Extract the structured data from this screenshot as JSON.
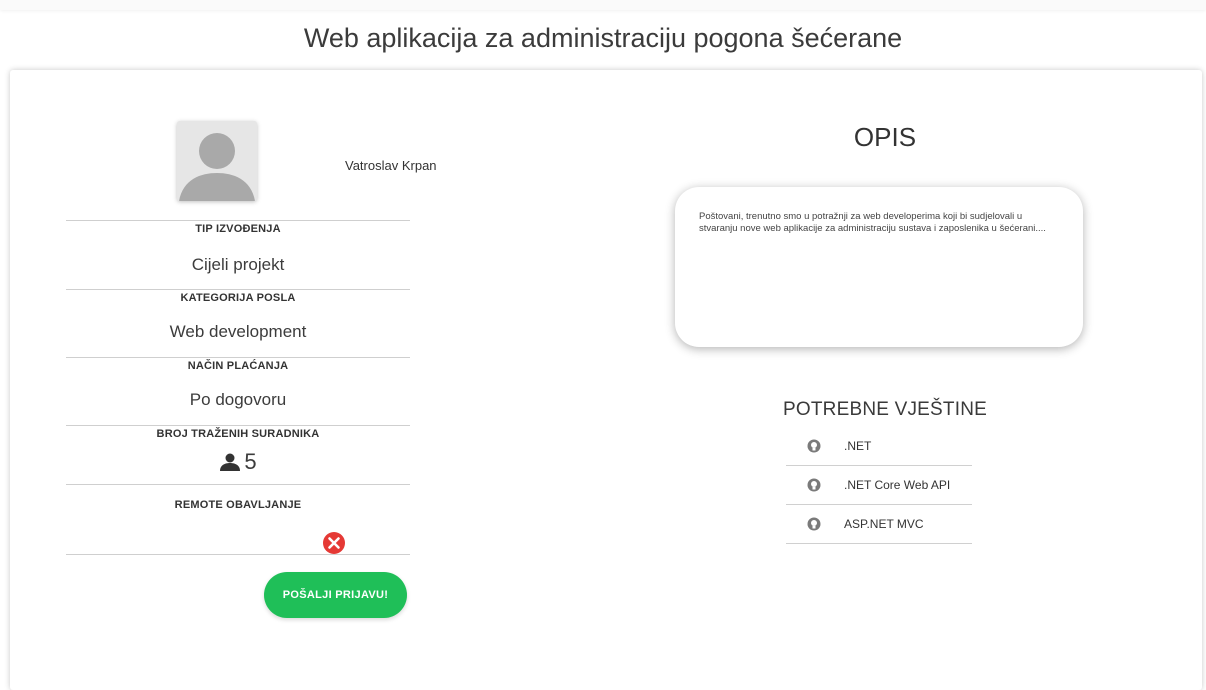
{
  "page": {
    "title": "Web aplikacija za administraciju pogona šećerane"
  },
  "job": {
    "author_name": "Vatroslav Krpan",
    "sections": [
      {
        "label": "TIP IZVOĐENJA",
        "value": "Cijeli projekt"
      },
      {
        "label": "KATEGORIJA POSLA",
        "value": "Web development"
      },
      {
        "label": "NAČIN PLAĆANJA",
        "value": "Po dogovoru"
      }
    ],
    "collaborators": {
      "label": "BROJ TRAŽENIH SURADNIKA",
      "value": "5",
      "icon": "person-icon"
    },
    "remote": {
      "label": "REMOTE OBAVLJANJE",
      "allowed": false,
      "icon": "remote-no-icon"
    },
    "apply_button": "POŠALJI PRIJAVU!"
  },
  "description": {
    "heading": "OPIS",
    "text": "Poštovani, trenutno smo u potražnji za web developerima koji bi sudjelovali u stvaranju nove web aplikacije za administraciju sustava i zaposlenika u šećerani...."
  },
  "skills": {
    "heading": "POTREBNE VJEŠTINE",
    "items": [
      {
        "label": ".NET",
        "icon": "lightbulb-icon"
      },
      {
        "label": ".NET Core Web API",
        "icon": "lightbulb-icon"
      },
      {
        "label": "ASP.NET MVC",
        "icon": "lightbulb-icon"
      }
    ]
  },
  "colors": {
    "accent_green": "#1fbf58",
    "danger_red": "#e53935",
    "text": "#333333"
  }
}
